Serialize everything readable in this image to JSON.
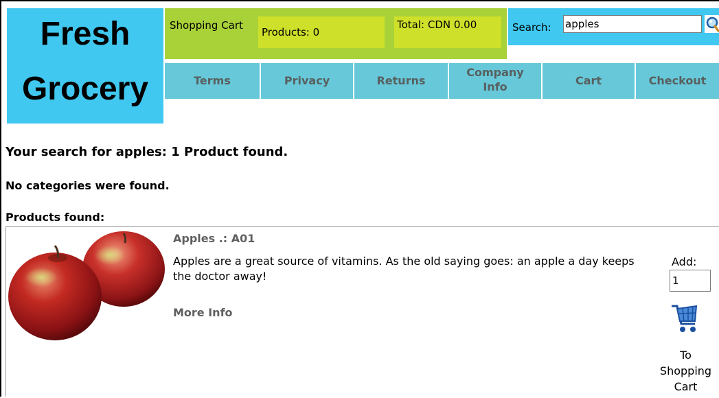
{
  "logo": {
    "line1": "Fresh",
    "line2": "Grocery"
  },
  "cart": {
    "title": "Shopping Cart",
    "products": "Products: 0",
    "total": "Total: CDN 0.00"
  },
  "search": {
    "label": "Search:",
    "value": "apples"
  },
  "nav": [
    "Terms",
    "Privacy",
    "Returns",
    "Company Info",
    "Cart",
    "Checkout"
  ],
  "results": {
    "summary": "Your search for apples: 1 Product found.",
    "categories": "No categories were found.",
    "products_heading": "Products found:"
  },
  "product": {
    "title": "Apples .: A01",
    "description": "Apples are a great source of vitamins. As the old saying goes: an apple a day keeps the doctor away!",
    "more_info": "More Info",
    "add_label": "Add:",
    "quantity": "1",
    "cart_button_label": "To Shopping Cart"
  },
  "icons": {
    "search": "magnifier-icon",
    "cart": "shopping-cart-icon",
    "product_image": "apples-image"
  },
  "colors": {
    "logo_bg": "#40c8f0",
    "cart_bar_bg": "#a8d238",
    "cart_cell_bg": "#cfe02a",
    "search_bg": "#40c8f0",
    "nav_bg": "#66c8d8",
    "nav_text": "#586060",
    "muted_text": "#606060"
  }
}
